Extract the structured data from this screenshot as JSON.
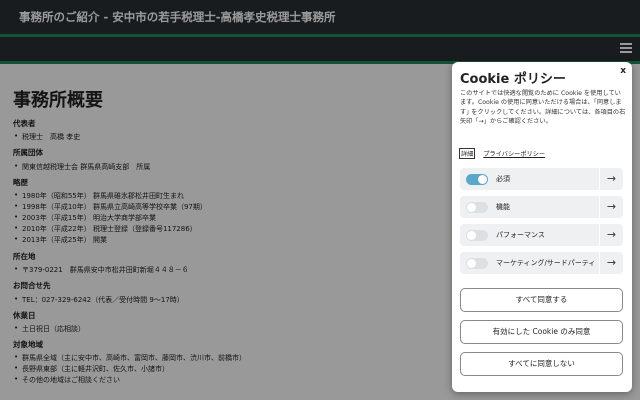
{
  "header": {
    "title": "事務所のご紹介 - 安中市の若手税理士-高橋孝史税理士事務所"
  },
  "main": {
    "heading": "事務所概要",
    "sections": [
      {
        "label": "代表者",
        "items": [
          "税理士　高橋 孝史"
        ]
      },
      {
        "label": "所属団体",
        "items": [
          "関東信越税理士会 群馬県高崎支部　所属"
        ]
      },
      {
        "label": "略歴",
        "items": [
          "1980年（昭和55年）  群馬県碓氷郡松井田町生まれ",
          "1998年（平成10年）  群馬県立高崎高等学校卒業（97期）",
          "2003年（平成15年）  明治大学商学部卒業",
          "2010年（平成22年）  税理士登録（登録番号117286）",
          "2013年（平成25年）  開業"
        ]
      },
      {
        "label": "所在地",
        "items": [
          "〒379-0221　群馬県安中市松井田町新堀４４８－６"
        ]
      },
      {
        "label": "お問合せ先",
        "items": [
          "TEL：027-329-6242（代表／受付時間 9～17時）"
        ]
      },
      {
        "label": "休業日",
        "items": [
          "土日祝日（応相談）"
        ]
      },
      {
        "label": "対象地域",
        "items": [
          "群馬県全域（主に安中市、高崎市、富岡市、藤岡市、渋川市、前橋市）",
          "長野県東部（主に軽井沢町、佐久市、小諸市）",
          "その他の地域はご相談ください"
        ]
      }
    ]
  },
  "cookie": {
    "title": "Cookie ポリシー",
    "close": "x",
    "description": "このサイトでは快適な閲覧のために Cookie を使用しています。Cookie の使用に同意いただける場合は、｢同意します｣ をクリックしてください。詳細については、各項目の右矢印「→」からご確認ください。",
    "detail_label": "詳細",
    "policy_link": "プライバシーポリシー",
    "categories": [
      {
        "label": "必須",
        "enabled": true
      },
      {
        "label": "機能",
        "enabled": false
      },
      {
        "label": "パフォーマンス",
        "enabled": false
      },
      {
        "label": "マーケティング/サードパーティ",
        "enabled": false
      }
    ],
    "arrow_glyph": "→",
    "buttons": {
      "accept_all": "すべて同意する",
      "accept_selected": "有効にした Cookie のみ同意",
      "reject_all": "すべてに同意しない"
    }
  }
}
